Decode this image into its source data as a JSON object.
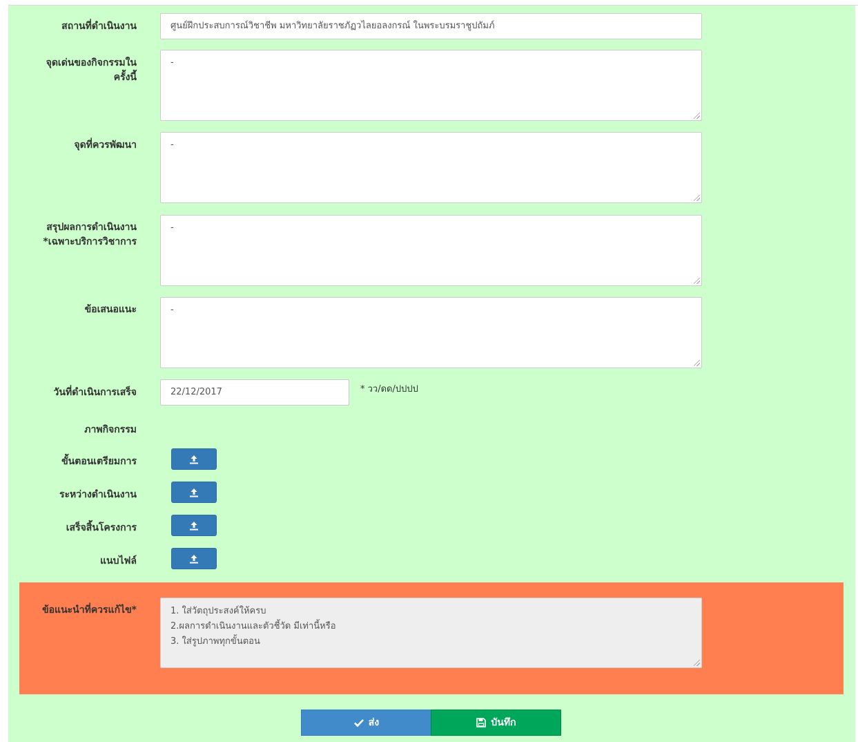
{
  "form": {
    "location": {
      "label": "สถานที่ดำเนินงาน",
      "value": "ศูนย์ฝึกประสบการณ์วิชาชีพ มหาวิทยาลัยราชภัฏวไลยอลงกรณ์ ในพระบรมราชูปถัมภ์"
    },
    "highlights": {
      "label_line1": "จุดเด่นของกิจกรรมใน",
      "label_line2": "ครั้งนี้",
      "value": "-"
    },
    "improve": {
      "label": "จุดที่ควรพัฒนา",
      "value": "-"
    },
    "summary": {
      "label_line1": "สรุปผลการดำเนินงาน",
      "label_line2": "*เฉพาะบริการวิชาการ",
      "value": "-"
    },
    "suggestion": {
      "label": "ข้อเสนอแนะ",
      "value": "-"
    },
    "completed_date": {
      "label": "วันที่ดำเนินการเสร็จ",
      "value": "22/12/2017",
      "hint": "* วว/ดด/ปปปป"
    },
    "photos": {
      "label": "ภาพกิจกรรม",
      "prepare": {
        "label": "ขั้นตอนเตรียมการ",
        "icon": "upload-icon"
      },
      "during": {
        "label": "ระหว่างดำเนินงาน",
        "icon": "upload-icon"
      },
      "finish": {
        "label": "เสร็จสิ้นโครงการ",
        "icon": "upload-icon"
      },
      "attach": {
        "label": "แนบไฟล์",
        "icon": "upload-icon"
      }
    },
    "fix_suggestion": {
      "label": "ข้อแนะนำที่ควรแก้ไข*",
      "lines": [
        "1. ใส่วัตถุประสงค์ให้ครบ",
        "2.ผลการดำเนินงานและตัวชี้วัด มีเท่านี้หรือ",
        "3. ใส่รูปภาพทุกขั้นตอน"
      ]
    }
  },
  "actions": {
    "send_label": "ส่ง",
    "send_icon": "check-icon",
    "save_label": "บันทึก",
    "save_icon": "floppy-disk-icon"
  },
  "colors": {
    "panel_bg": "#ccffcc",
    "suggestion_bg": "#ff7f50",
    "primary": "#337ab7",
    "success": "#00a65a"
  }
}
